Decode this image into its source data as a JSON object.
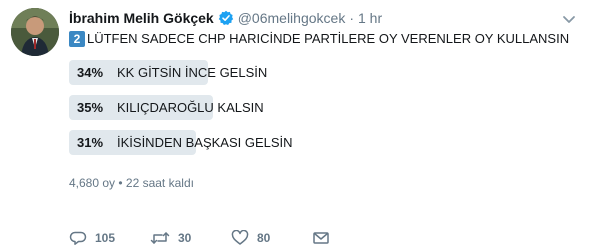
{
  "tweet": {
    "author_name": "İbrahim Melih Gökçek",
    "handle": "@06melihgokcek",
    "dot": "·",
    "time": "1 hr",
    "keycap": "2",
    "text": "LÜTFEN SADECE CHP HARICİNDE PARTİLERE OY VERENLER OY KULLANSIN"
  },
  "poll": {
    "options": [
      {
        "percent_label": "34%",
        "fraction": 0.34,
        "label": "KK GİTSİN İNCE GELSİN"
      },
      {
        "percent_label": "35%",
        "fraction": 0.35,
        "label": "KILIÇDAROĞLU KALSIN"
      },
      {
        "percent_label": "31%",
        "fraction": 0.31,
        "label": "İKİSİNDEN BAŞKASI GELSİN"
      }
    ],
    "summary": "4,680 oy • 22 saat kaldı"
  },
  "actions": {
    "replies": "105",
    "retweets": "30",
    "likes": "80"
  },
  "icons": {
    "verified": "verified-badge-icon",
    "caret": "chevron-down-icon",
    "reply": "reply-icon",
    "retweet": "retweet-icon",
    "like": "heart-icon",
    "message": "direct-message-icon"
  },
  "colors": {
    "verified": "#1da1f2",
    "poll_bar": "#e1e8ed",
    "secondary_text": "#657786",
    "keycap": "#3b88c3"
  }
}
